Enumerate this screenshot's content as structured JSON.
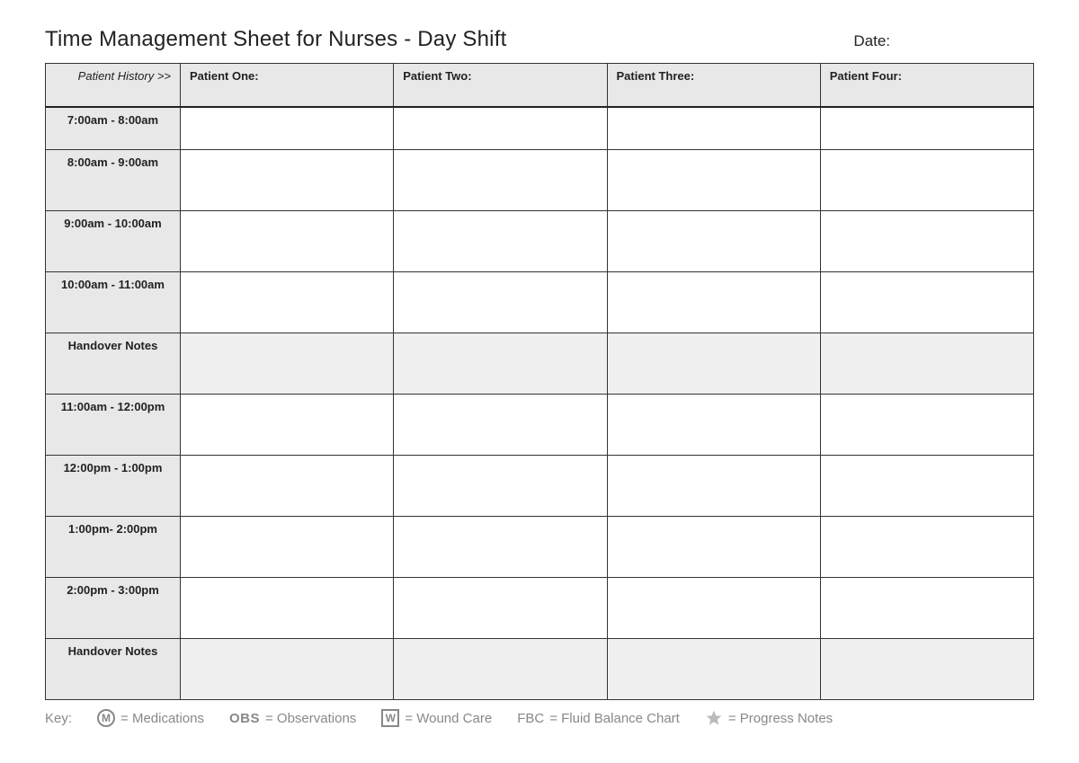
{
  "header": {
    "title": "Time Management Sheet for Nurses - Day Shift",
    "date_label": "Date:"
  },
  "table": {
    "history_label": "Patient History >>",
    "patients": [
      "Patient One:",
      "Patient Two:",
      "Patient Three:",
      "Patient Four:"
    ],
    "rows": [
      {
        "label": "7:00am - 8:00am",
        "shaded": false
      },
      {
        "label": "8:00am - 9:00am",
        "shaded": false
      },
      {
        "label": "9:00am - 10:00am",
        "shaded": false
      },
      {
        "label": "10:00am - 11:00am",
        "shaded": false
      },
      {
        "label": "Handover Notes",
        "shaded": true
      },
      {
        "label": "11:00am - 12:00pm",
        "shaded": false
      },
      {
        "label": "12:00pm - 1:00pm",
        "shaded": false
      },
      {
        "label": "1:00pm- 2:00pm",
        "shaded": false
      },
      {
        "label": "2:00pm - 3:00pm",
        "shaded": false
      },
      {
        "label": "Handover Notes",
        "shaded": true
      }
    ]
  },
  "key": {
    "label": "Key:",
    "items": [
      {
        "icon": "circle-m",
        "text": "= Medications"
      },
      {
        "icon": "obs",
        "text": "= Observations",
        "obs_label": "OBS"
      },
      {
        "icon": "square-w",
        "text": "= Wound Care"
      },
      {
        "icon": "fbc",
        "text": "= Fluid Balance Chart",
        "fbc_label": "FBC"
      },
      {
        "icon": "star",
        "text": "= Progress Notes"
      }
    ]
  }
}
